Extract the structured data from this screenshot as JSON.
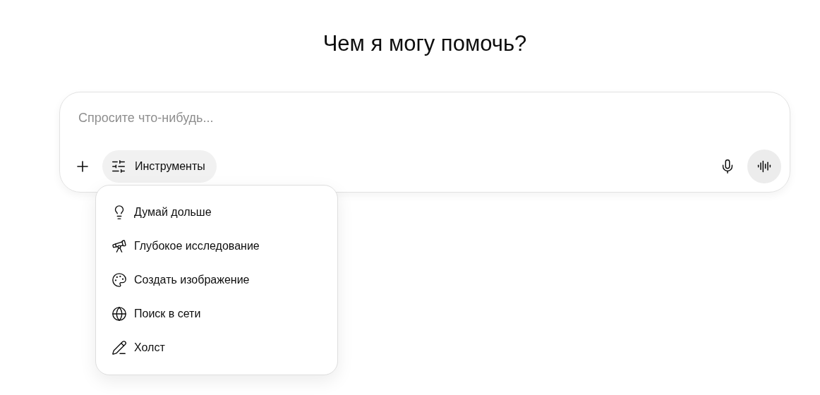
{
  "heading": "Чем я могу помочь?",
  "composer": {
    "placeholder": "Спросите что-нибудь...",
    "tools_button": "Инструменты"
  },
  "tools_menu": [
    {
      "kind": "think",
      "label": "Думай дольше"
    },
    {
      "kind": "research",
      "label": "Глубокое исследование"
    },
    {
      "kind": "image",
      "label": "Создать изображение"
    },
    {
      "kind": "web",
      "label": "Поиск в сети"
    },
    {
      "kind": "canvas",
      "label": "Холст"
    }
  ]
}
